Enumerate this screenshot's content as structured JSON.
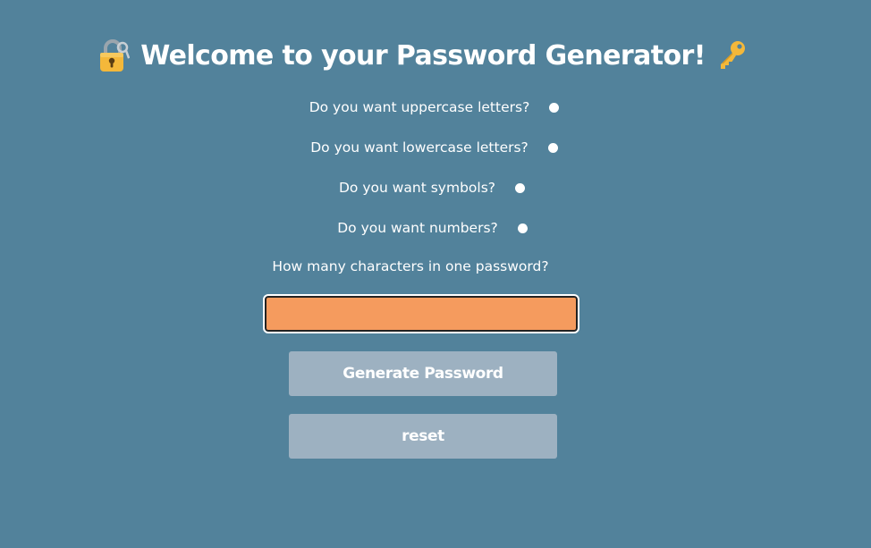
{
  "header": {
    "title": "Welcome to your Password Generator!",
    "left_icon": "locked-with-key-icon",
    "right_icon": "key-icon"
  },
  "options": {
    "uppercase_label": "Do you want uppercase letters?",
    "lowercase_label": "Do you want lowercase letters?",
    "symbols_label": "Do you want symbols?",
    "numbers_label": "Do you want numbers?"
  },
  "length": {
    "label": "How many characters in one password?",
    "value": "",
    "placeholder": ""
  },
  "buttons": {
    "generate_label": "Generate Password",
    "reset_label": "reset"
  },
  "colors": {
    "background": "#52829b",
    "input_fill": "#f59b5e",
    "button_fill": "#9db1c1",
    "text": "#ffffff"
  }
}
